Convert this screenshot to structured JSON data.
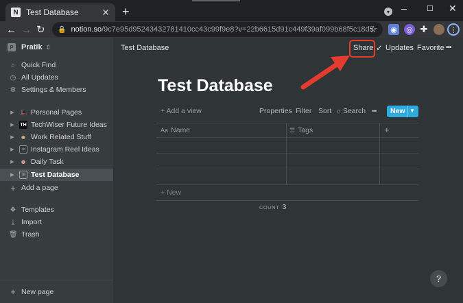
{
  "browser": {
    "tab_title": "Test Database",
    "tab_favicon": "N",
    "tab_close": "✕",
    "new_tab": "+",
    "url_host": "notion.so",
    "url_path": "/9c7e95d95243432781410cc43c99f9e8?v=22b6615d91c449f39af099b68f5c18d5",
    "window_controls": {
      "minimize": "–",
      "maximize": "☐",
      "close": "✕"
    }
  },
  "sidebar": {
    "workspace_name": "Pratik",
    "workspace_badge": "P",
    "nav": [
      {
        "label": "Quick Find",
        "icon": "search-icon"
      },
      {
        "label": "All Updates",
        "icon": "clock-icon"
      },
      {
        "label": "Settings & Members",
        "icon": "gear-icon"
      }
    ],
    "pages": [
      {
        "label": "Personal Pages",
        "icon": "hat-emoji-icon"
      },
      {
        "label": "TechWiser Future Ideas",
        "icon": "techwiser-logo-icon"
      },
      {
        "label": "Work Related Stuff",
        "icon": "person-emoji-icon"
      },
      {
        "label": "Instagram Reel Ideas",
        "icon": "page-icon"
      },
      {
        "label": "Daily Task",
        "icon": "person-emoji-icon"
      },
      {
        "label": "Test Database",
        "icon": "page-icon",
        "active": true
      }
    ],
    "add_page": "Add a page",
    "tools": [
      {
        "label": "Templates",
        "icon": "templates-icon"
      },
      {
        "label": "Import",
        "icon": "import-icon"
      },
      {
        "label": "Trash",
        "icon": "trash-icon"
      }
    ],
    "new_page": "New page"
  },
  "topbar": {
    "breadcrumb": "Test Database",
    "share": "Share",
    "updates": "Updates",
    "favorite": "Favorite",
    "more": "•••"
  },
  "page": {
    "title": "Test Database"
  },
  "database": {
    "add_view": "Add a view",
    "options": [
      "Properties",
      "Filter",
      "Sort",
      "Search"
    ],
    "more": "•••",
    "new_button": "New",
    "columns": [
      {
        "label": "Name",
        "icon": "text-property-icon"
      },
      {
        "label": "Tags",
        "icon": "list-property-icon"
      }
    ],
    "add_column": "+",
    "row_count": 3,
    "add_row": "New",
    "count_label": "COUNT",
    "count_value": "3"
  },
  "help": "?",
  "colors": {
    "accent_blue": "#2eaadc",
    "annotation_red": "#e33b2e",
    "sidebar_bg": "#373c3f",
    "main_bg": "#2f3437"
  }
}
